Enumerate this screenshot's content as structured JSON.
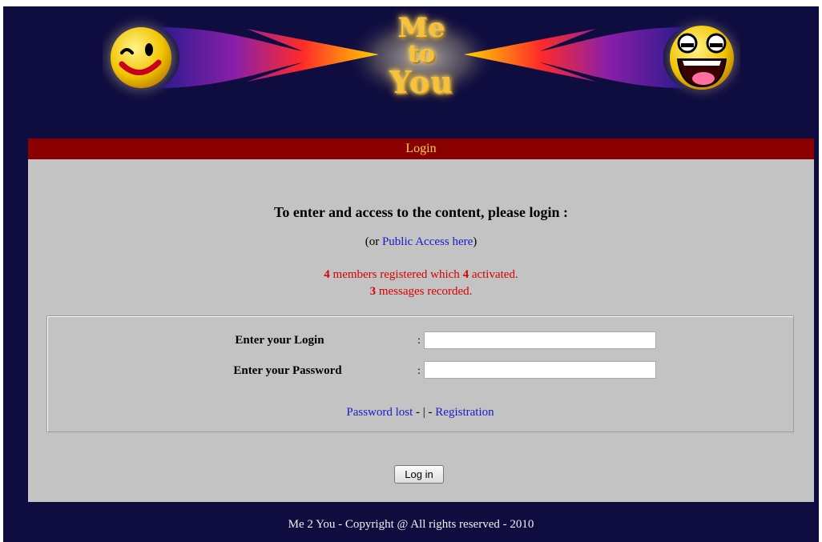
{
  "banner": {
    "word1": "Me",
    "word2": "to",
    "word3": "You",
    "left_icon": "winking-smiley-icon",
    "right_icon": "laughing-smiley-icon"
  },
  "panel": {
    "title": "Login",
    "heading": "To enter and access to the content, please login :",
    "public_prefix": "(or ",
    "public_link": "Public Access here",
    "public_suffix": ")",
    "members_count": "4",
    "members_text": " members registered which ",
    "activated_count": "4",
    "activated_text": " activated.",
    "messages_count": "3",
    "messages_text": " messages recorded."
  },
  "form": {
    "login_label": "Enter your Login",
    "password_label": "Enter your Password",
    "colon": ":",
    "login_value": "",
    "password_value": "",
    "password_lost_link": "Password lost",
    "separator": " - | - ",
    "registration_link": "Registration",
    "submit_label": "Log in"
  },
  "footer": {
    "text": "Me 2 You - Copyright @ All rights reserved - 2010"
  },
  "colors": {
    "background": "#0f0d40",
    "header_bar": "#8b0000",
    "panel": "#c3c3c3",
    "link": "#1a1acc",
    "stats": "#d80000"
  }
}
